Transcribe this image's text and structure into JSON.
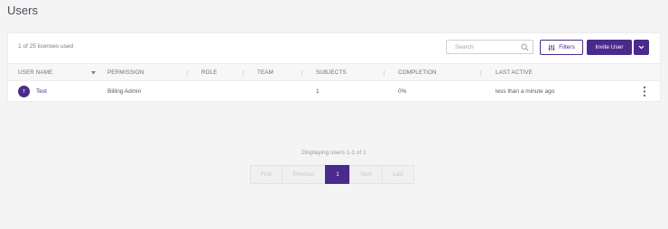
{
  "page": {
    "title": "Users"
  },
  "toolbar": {
    "license_text": "1 of 25 licenses used",
    "search_placeholder": "Search",
    "filters_label": "Filters",
    "invite_label": "Invite User"
  },
  "table": {
    "columns": [
      "USER NAME",
      "PERMISSION",
      "ROLE",
      "TEAM",
      "SUBJECTS",
      "COMPLETION",
      "LAST ACTIVE"
    ],
    "sorted_column": "USER NAME",
    "sort_direction": "descending",
    "rows": [
      {
        "avatar_initial": "T",
        "user_name": "Test",
        "permission": "Billing Admin",
        "role": "",
        "team": "",
        "subjects": "1",
        "completion": "0%",
        "last_active": "less than a minute ago"
      }
    ]
  },
  "pagination": {
    "summary": "Displaying users 1-1 of 1",
    "first": "First",
    "previous": "Previous",
    "current": "1",
    "next": "Next",
    "last": "Last"
  },
  "colors": {
    "accent": "#4a2a8c",
    "background": "#f4f4f5"
  }
}
